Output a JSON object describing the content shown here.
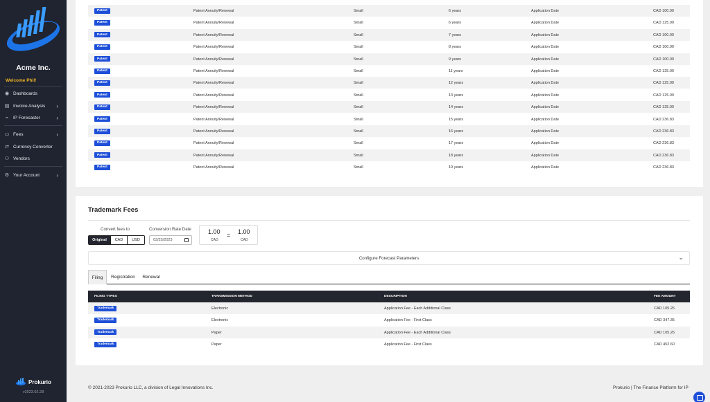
{
  "sidebar": {
    "company": "Acme Inc.",
    "welcome": "Welcome Phil!",
    "items": [
      {
        "label": "Dashboards"
      },
      {
        "label": "Invoice Analysis"
      },
      {
        "label": "IP Forecaster"
      },
      {
        "label": "Fees"
      },
      {
        "label": "Currency Converter"
      },
      {
        "label": "Vendors"
      },
      {
        "label": "Your Account"
      }
    ],
    "brand": "Prokurio",
    "version": "v2023.02.28"
  },
  "patent_rows": [
    {
      "type": "Patent",
      "fee": "Patent Annuity/Renewal",
      "size": "Small",
      "term": "6 years",
      "basis": "Application Date",
      "amount": "CAD 100.00"
    },
    {
      "type": "Patent",
      "fee": "Patent Annuity/Renewal",
      "size": "Small",
      "term": "6 years",
      "basis": "Application Date",
      "amount": "CAD 125.00"
    },
    {
      "type": "Patent",
      "fee": "Patent Annuity/Renewal",
      "size": "Small",
      "term": "7 years",
      "basis": "Application Date",
      "amount": "CAD 100.00"
    },
    {
      "type": "Patent",
      "fee": "Patent Annuity/Renewal",
      "size": "Small",
      "term": "8 years",
      "basis": "Application Date",
      "amount": "CAD 100.00"
    },
    {
      "type": "Patent",
      "fee": "Patent Annuity/Renewal",
      "size": "Small",
      "term": "9 years",
      "basis": "Application Date",
      "amount": "CAD 100.00"
    },
    {
      "type": "Patent",
      "fee": "Patent Annuity/Renewal",
      "size": "Small",
      "term": "11 years",
      "basis": "Application Date",
      "amount": "CAD 125.00"
    },
    {
      "type": "Patent",
      "fee": "Patent Annuity/Renewal",
      "size": "Small",
      "term": "12 years",
      "basis": "Application Date",
      "amount": "CAD 125.00"
    },
    {
      "type": "Patent",
      "fee": "Patent Annuity/Renewal",
      "size": "Small",
      "term": "13 years",
      "basis": "Application Date",
      "amount": "CAD 125.00"
    },
    {
      "type": "Patent",
      "fee": "Patent Annuity/Renewal",
      "size": "Small",
      "term": "14 years",
      "basis": "Application Date",
      "amount": "CAD 125.00"
    },
    {
      "type": "Patent",
      "fee": "Patent Annuity/Renewal",
      "size": "Small",
      "term": "15 years",
      "basis": "Application Date",
      "amount": "CAD 236.83"
    },
    {
      "type": "Patent",
      "fee": "Patent Annuity/Renewal",
      "size": "Small",
      "term": "16 years",
      "basis": "Application Date",
      "amount": "CAD 236.83"
    },
    {
      "type": "Patent",
      "fee": "Patent Annuity/Renewal",
      "size": "Small",
      "term": "17 years",
      "basis": "Application Date",
      "amount": "CAD 236.83"
    },
    {
      "type": "Patent",
      "fee": "Patent Annuity/Renewal",
      "size": "Small",
      "term": "18 years",
      "basis": "Application Date",
      "amount": "CAD 236.83"
    },
    {
      "type": "Patent",
      "fee": "Patent Annuity/Renewal",
      "size": "Small",
      "term": "19 years",
      "basis": "Application Date",
      "amount": "CAD 236.83"
    }
  ],
  "trademark": {
    "title": "Trademark Fees",
    "convert_label": "Convert fees to",
    "currency_options": [
      "Original",
      "CAD",
      "USD"
    ],
    "selected_currency": "Original",
    "rate_date_label": "Conversion Rate Date",
    "rate_date": "03/25/2023",
    "rate_left": "1.00",
    "rate_left_cur": "CAD",
    "rate_eq": "=",
    "rate_right": "1.00",
    "rate_right_cur": "CAD",
    "configure_label": "Configure Forecast Parameters",
    "tabs": [
      "Filing",
      "Registration",
      "Renewal"
    ],
    "active_tab": "Filing",
    "headers": [
      "FILING TYPES",
      "TRANSMISSION METHOD",
      "DESCRIPTION",
      "FEE AMOUNT"
    ],
    "rows": [
      {
        "type": "Trademark",
        "method": "Electronic",
        "desc": "Application Fee - Each Additional Class",
        "amount": "CAD 105.26"
      },
      {
        "type": "Trademark",
        "method": "Electronic",
        "desc": "Application Fee - First Class",
        "amount": "CAD 347.35"
      },
      {
        "type": "Trademark",
        "method": "Paper",
        "desc": "Application Fee - Each Additional Class",
        "amount": "CAD 105.26"
      },
      {
        "type": "Trademark",
        "method": "Paper",
        "desc": "Application Fee - First Class",
        "amount": "CAD 452.60"
      }
    ]
  },
  "footer": {
    "copyright": "© 2021-2023 Prokurio LLC, a division of Legal Innovations Inc.",
    "tagline": "Prokurio | The Finance Platform for IP"
  },
  "colors": {
    "sidebar": "#1f2430",
    "accent": "#1d4fd8",
    "warning": "#f0b429",
    "header": "#23262f"
  }
}
